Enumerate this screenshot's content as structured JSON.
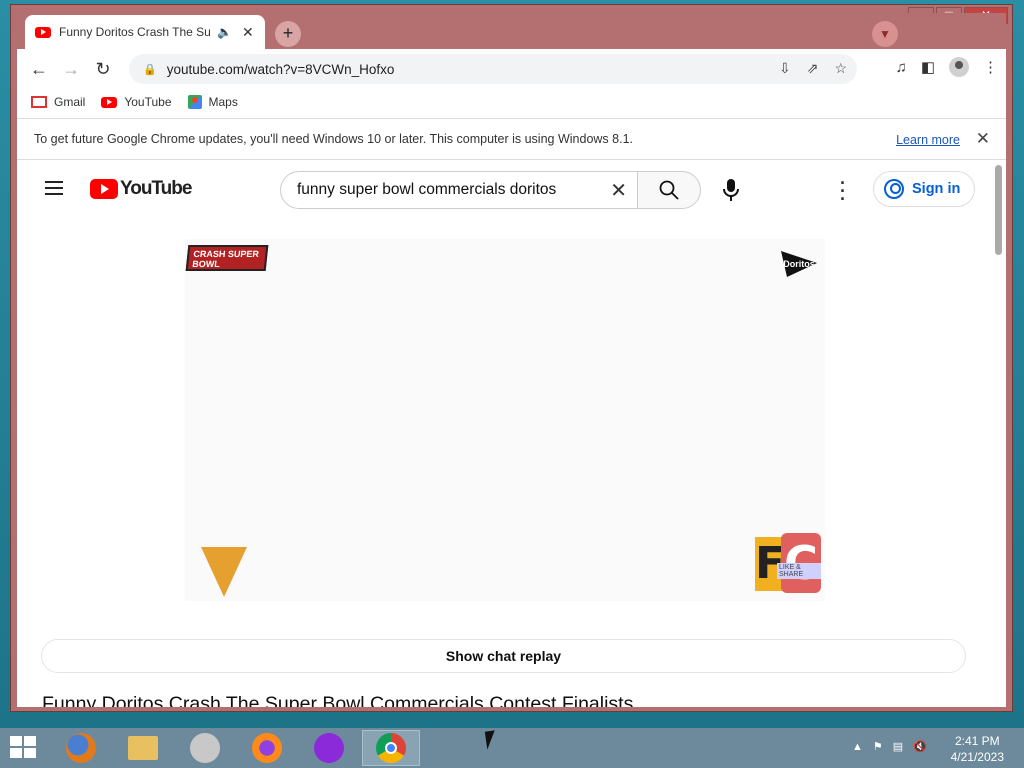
{
  "browser": {
    "tab_title": "Funny Doritos Crash The Super Bowl Commercials Contest Finalists",
    "new_tab": "+",
    "url": "youtube.com/watch?v=8VCWn_Hofxo",
    "bookmarks": [
      "Gmail",
      "YouTube",
      "Maps"
    ],
    "infobar_text": "To get future Google Chrome updates, you'll need Windows 10 or later. This computer is using Windows 8.1.",
    "learn_more": "Learn more"
  },
  "youtube": {
    "logo_text": "YouTube",
    "search_query": "funny super bowl commercials doritos",
    "sign_in": "Sign in",
    "chat_replay": "Show chat replay",
    "video_title": "Funny Doritos Crash The Super Bowl Commercials Contest Finalists"
  },
  "player_overlay": {
    "crash_logo_text": "CRASH SUPER BOWL",
    "doritos_logo_text": "Doritos",
    "fc_logo_letters": "FC",
    "fc_badge": "LIKE & SHARE"
  },
  "taskbar": {
    "time": "2:41 PM",
    "date": "4/21/2023"
  },
  "colors": {
    "youtube_red": "#ff0000",
    "window_frame": "#b47070",
    "link_blue": "#065fd4"
  }
}
